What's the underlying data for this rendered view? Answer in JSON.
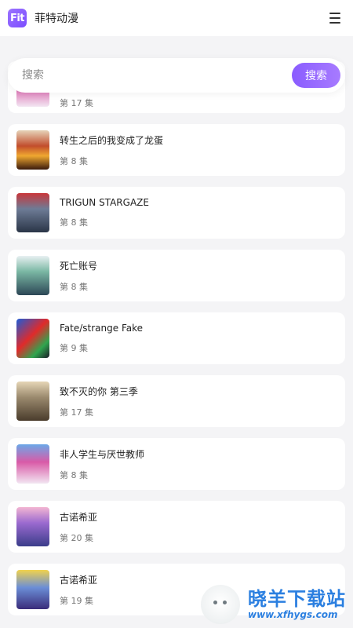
{
  "header": {
    "logo_text": "Fit",
    "title": "菲特动漫",
    "menu_icon": "hamburger-menu-icon"
  },
  "search": {
    "placeholder": "搜索",
    "button_label": "搜索"
  },
  "list": {
    "items": [
      {
        "title": "",
        "episode": "",
        "thumb": "t-a"
      },
      {
        "title": "",
        "episode": "第 17 集",
        "thumb": "t-g"
      },
      {
        "title": "转生之后的我变成了龙蛋",
        "episode": "第 8 集",
        "thumb": "t-b"
      },
      {
        "title": "TRIGUN STARGAZE",
        "episode": "第 8 集",
        "thumb": "t-c"
      },
      {
        "title": "死亡账号",
        "episode": "第 8 集",
        "thumb": "t-d"
      },
      {
        "title": "Fate/strange Fake",
        "episode": "第 9 集",
        "thumb": "t-e"
      },
      {
        "title": "致不灭的你 第三季",
        "episode": "第 17 集",
        "thumb": "t-f"
      },
      {
        "title": "非人学生与厌世教师",
        "episode": "第 8 集",
        "thumb": "t-g"
      },
      {
        "title": "古诺希亚",
        "episode": "第 20 集",
        "thumb": "t-h"
      },
      {
        "title": "古诺希亚",
        "episode": "第 19 集",
        "thumb": "t-i"
      }
    ]
  },
  "watermark": {
    "title": "晓羊下载站",
    "url": "www.xfhygs.com"
  },
  "colors": {
    "accent": "#8a5cff",
    "background": "#f4f4f6",
    "watermark": "#2b7fe0"
  }
}
